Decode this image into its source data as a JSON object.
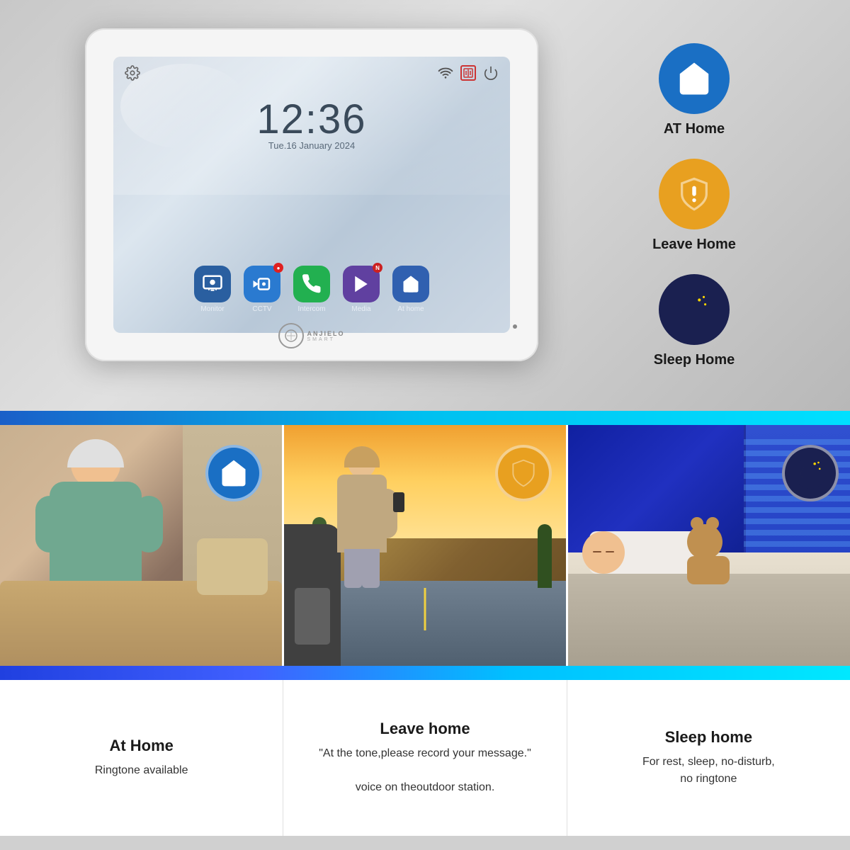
{
  "top": {
    "device": {
      "time": "12:36",
      "date": "Tue.16 January 2024",
      "apps": [
        {
          "label": "Monitor",
          "color": "app-monitor"
        },
        {
          "label": "CCTV",
          "color": "app-cctv",
          "badge": "●"
        },
        {
          "label": "Intercom",
          "color": "app-intercom"
        },
        {
          "label": "Media",
          "color": "app-media",
          "badge": "N"
        },
        {
          "label": "At home",
          "color": "app-athome"
        }
      ],
      "brand": "ANJIELO"
    },
    "modes": [
      {
        "label": "AT Home",
        "circle": "mode-circle-blue"
      },
      {
        "label": "Leave Home",
        "circle": "mode-circle-gold"
      },
      {
        "label": "Sleep Home",
        "circle": "mode-circle-dark"
      }
    ]
  },
  "photos": [
    {
      "mode": "athome",
      "icon_color": "photo-icon-blue"
    },
    {
      "mode": "leavehome",
      "icon_color": "photo-icon-gold"
    },
    {
      "mode": "sleep",
      "icon_color": "photo-icon-dark"
    }
  ],
  "bottom": [
    {
      "title": "At Home",
      "desc": "Ringtone available"
    },
    {
      "title": "Leave home",
      "desc": "\"At the tone,please record your message.\"\n\nvoice on theoutdoor station."
    },
    {
      "title": "Sleep home",
      "desc": "For rest, sleep, no-disturb,\nno ringtone"
    }
  ]
}
